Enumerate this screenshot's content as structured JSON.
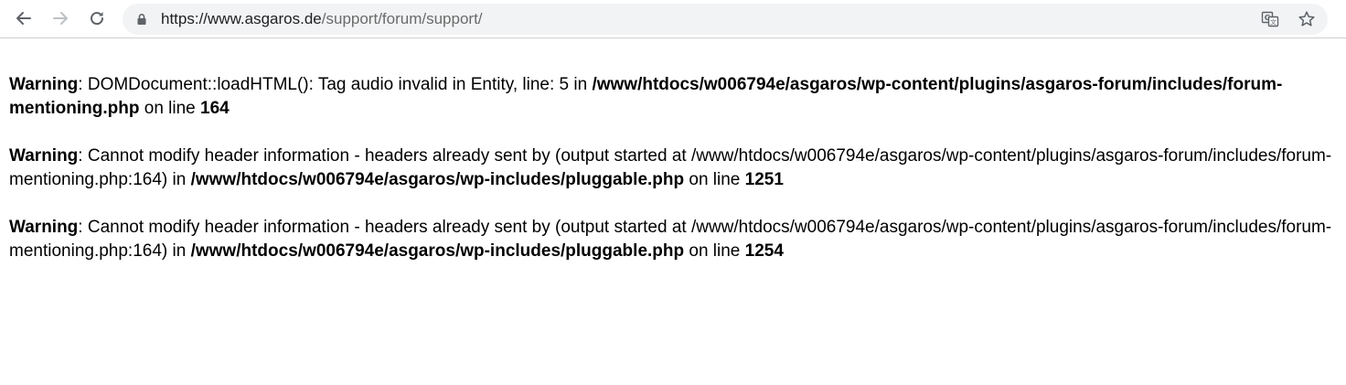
{
  "browser": {
    "url_host": "https://www.asgaros.de",
    "url_path": "/support/forum/support/",
    "icons": {
      "back": "arrow-left-icon",
      "forward": "arrow-right-icon",
      "reload": "reload-icon",
      "lock": "lock-icon",
      "translate": "translate-icon",
      "bookmark": "star-icon"
    }
  },
  "warnings": [
    {
      "label": "Warning",
      "message": ": DOMDocument::loadHTML(): Tag audio invalid in Entity, line: 5 in ",
      "file": "/www/htdocs/w006794e/asgaros/wp-content/plugins/asgaros-forum/includes/forum-mentioning.php",
      "on_line_text": " on line ",
      "line": "164"
    },
    {
      "label": "Warning",
      "message": ": Cannot modify header information - headers already sent by (output started at /www/htdocs/w006794e/asgaros/wp-content/plugins/asgaros-forum/includes/forum-mentioning.php:164) in ",
      "file": "/www/htdocs/w006794e/asgaros/wp-includes/pluggable.php",
      "on_line_text": " on line ",
      "line": "1251"
    },
    {
      "label": "Warning",
      "message": ": Cannot modify header information - headers already sent by (output started at /www/htdocs/w006794e/asgaros/wp-content/plugins/asgaros-forum/includes/forum-mentioning.php:164) in ",
      "file": "/www/htdocs/w006794e/asgaros/wp-includes/pluggable.php",
      "on_line_text": " on line ",
      "line": "1254"
    }
  ]
}
